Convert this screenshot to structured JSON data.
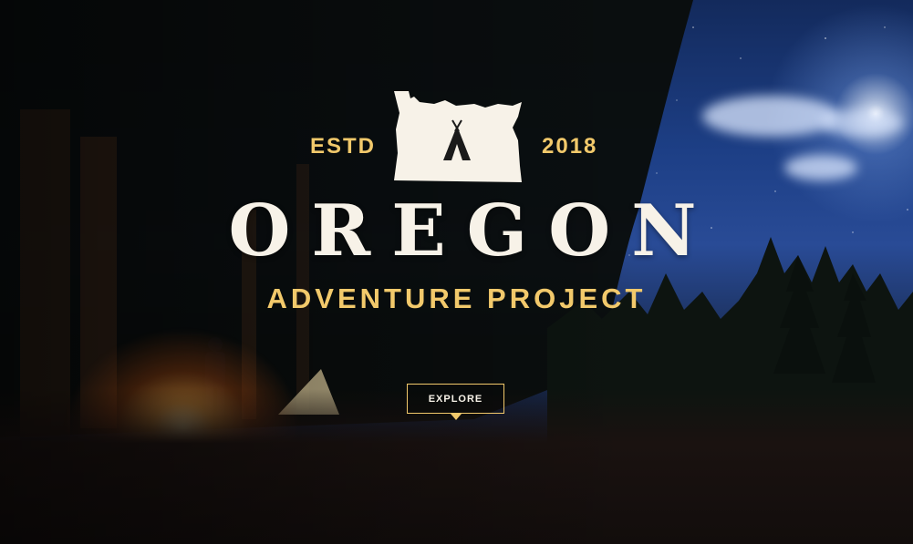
{
  "hero": {
    "estd_label": "ESTD",
    "year": "2018",
    "title": "OREGON",
    "subtitle": "ADVENTURE PROJECT",
    "explore_label": "EXPLORE",
    "logo_icon": "oregon-state-tent-icon",
    "scene": "night campsite with campfire under a starry sky"
  },
  "colors": {
    "accent": "#f2c96b",
    "title": "#f7f2e8",
    "sky": "#1d3f86"
  }
}
